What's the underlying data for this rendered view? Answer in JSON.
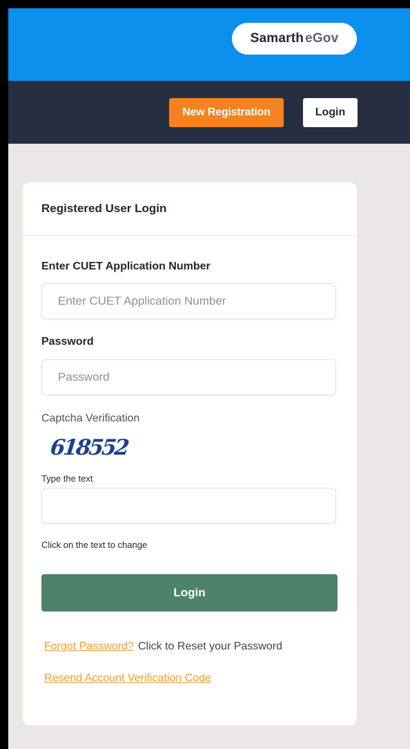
{
  "header": {
    "brand_main": "Samarth",
    "brand_sub": "eGov"
  },
  "nav": {
    "new_registration": "New Registration",
    "login": "Login"
  },
  "card": {
    "title": "Registered User Login",
    "application_label": "Enter CUET Application Number",
    "application_placeholder": "Enter CUET Application Number",
    "application_value": "",
    "password_label": "Password",
    "password_placeholder": "Password",
    "password_value": "",
    "captcha_label": "Captcha Verification",
    "captcha_text": "618552",
    "type_text_label": "Type the text",
    "captcha_value": "",
    "captcha_hint": "Click on the text to change",
    "submit_label": "Login",
    "forgot_link": "Forgot Password?",
    "forgot_desc": "Click to Reset your Password",
    "resend_link": "Resend Account Verification Code"
  },
  "colors": {
    "topbar": "#0b8fed",
    "navbar": "#252f41",
    "accent_orange": "#f5821f",
    "submit_green": "#4e826b",
    "link_orange": "#f39a2a"
  }
}
